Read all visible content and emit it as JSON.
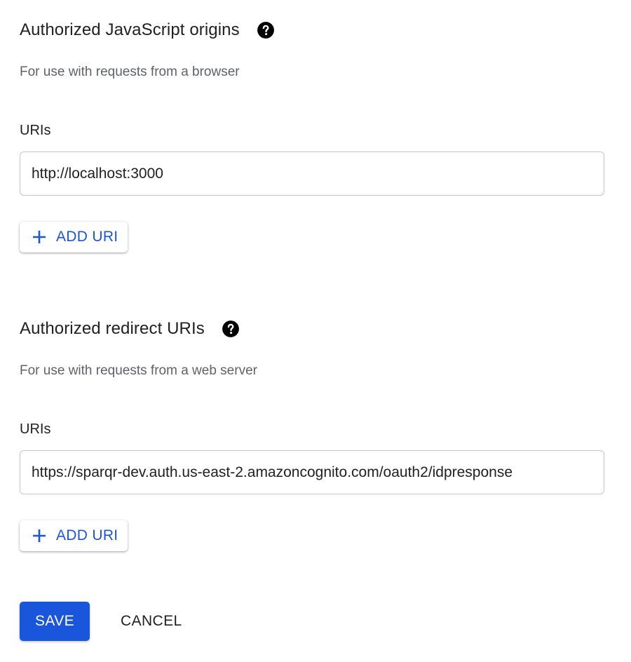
{
  "javascript_origins": {
    "heading": "Authorized JavaScript origins",
    "help_icon": "help-circle-icon",
    "description": "For use with requests from a browser",
    "uris_label": "URIs",
    "uri_value": "http://localhost:3000",
    "add_uri_label": "ADD URI",
    "add_icon": "plus-icon"
  },
  "redirect_uris": {
    "heading": "Authorized redirect URIs",
    "help_icon": "help-circle-icon",
    "description": "For use with requests from a web server",
    "uris_label": "URIs",
    "uri_value": "https://sparqr-dev.auth.us-east-2.amazoncognito.com/oauth2/idpresponse",
    "add_uri_label": "ADD URI",
    "add_icon": "plus-icon"
  },
  "actions": {
    "save_label": "SAVE",
    "cancel_label": "CANCEL"
  },
  "colors": {
    "primary": "#1a56db",
    "text": "#202124",
    "secondary_text": "#5f6368",
    "input_border": "#c4c7c9"
  }
}
